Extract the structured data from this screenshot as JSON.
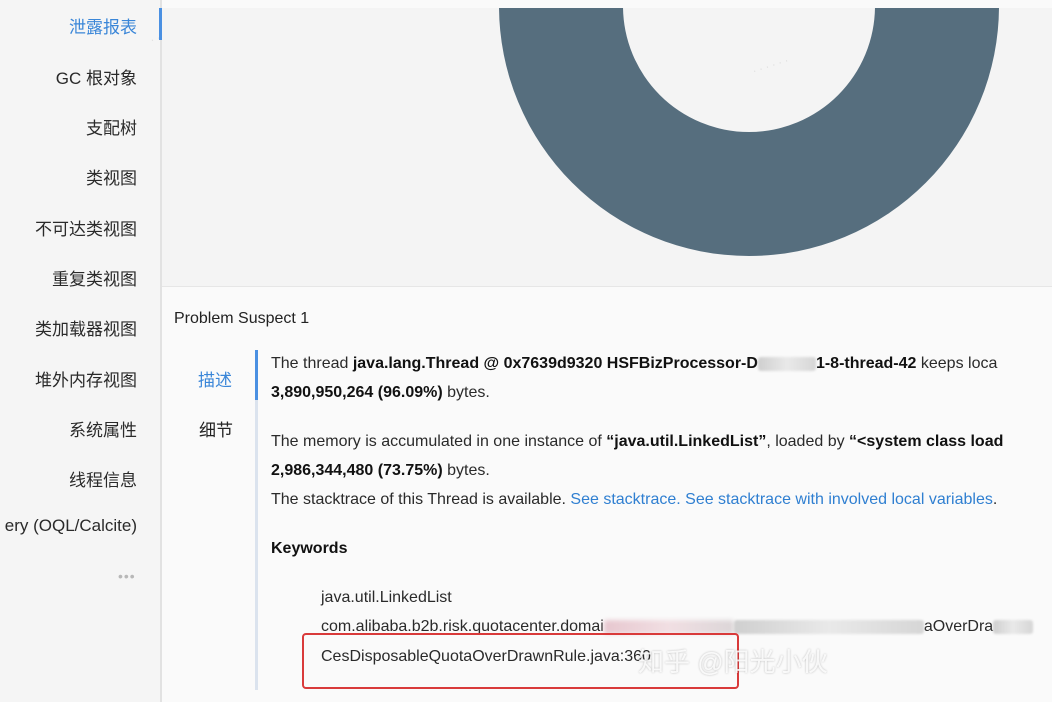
{
  "sidebar": {
    "items": [
      {
        "label": "泄露报表",
        "active": true
      },
      {
        "label": "GC 根对象"
      },
      {
        "label": "支配树"
      },
      {
        "label": "类视图"
      },
      {
        "label": "不可达类视图"
      },
      {
        "label": "重复类视图"
      },
      {
        "label": "类加载器视图"
      },
      {
        "label": "堆外内存视图"
      },
      {
        "label": "系统属性"
      },
      {
        "label": "线程信息"
      },
      {
        "label": "ery (OQL/Calcite)"
      }
    ],
    "more": "•••"
  },
  "chart": {
    "ring_color": "#566e7e"
  },
  "problem": {
    "title": "Problem Suspect 1",
    "tabs": [
      "描述",
      "细节"
    ],
    "line1_pre": "The thread ",
    "line1_bold": "java.lang.Thread @ 0x7639d9320 HSFBizProcessor-D",
    "line1_bold_after": "1-8-thread-42",
    "line1_post": " keeps loca",
    "line2_bold": "3,890,950,264 (96.09%)",
    "line2_post": " bytes.",
    "line3_pre": "The memory is accumulated in one instance of ",
    "line3_bold": "“java.util.LinkedList”",
    "line3_mid": ", loaded by ",
    "line3_bold2": "“<system class load",
    "line4_bold": "2,986,344,480 (73.75%)",
    "line4_post": " bytes.",
    "line5_pre": "The stacktrace of this Thread is available. ",
    "link1": "See stacktrace.",
    "link2": "See stacktrace with involved local variables",
    "line5_post": "."
  },
  "keywords": {
    "title": "Keywords",
    "items": [
      "java.util.LinkedList",
      "com.alibaba.b2b.risk.quotacenter.domai",
      "CesDisposableQuotaOverDrawnRule.java:360"
    ],
    "item2_tail": "aOverDra"
  },
  "watermark": "知乎 @阳光小伙",
  "highlight_color": "#d93a3a"
}
